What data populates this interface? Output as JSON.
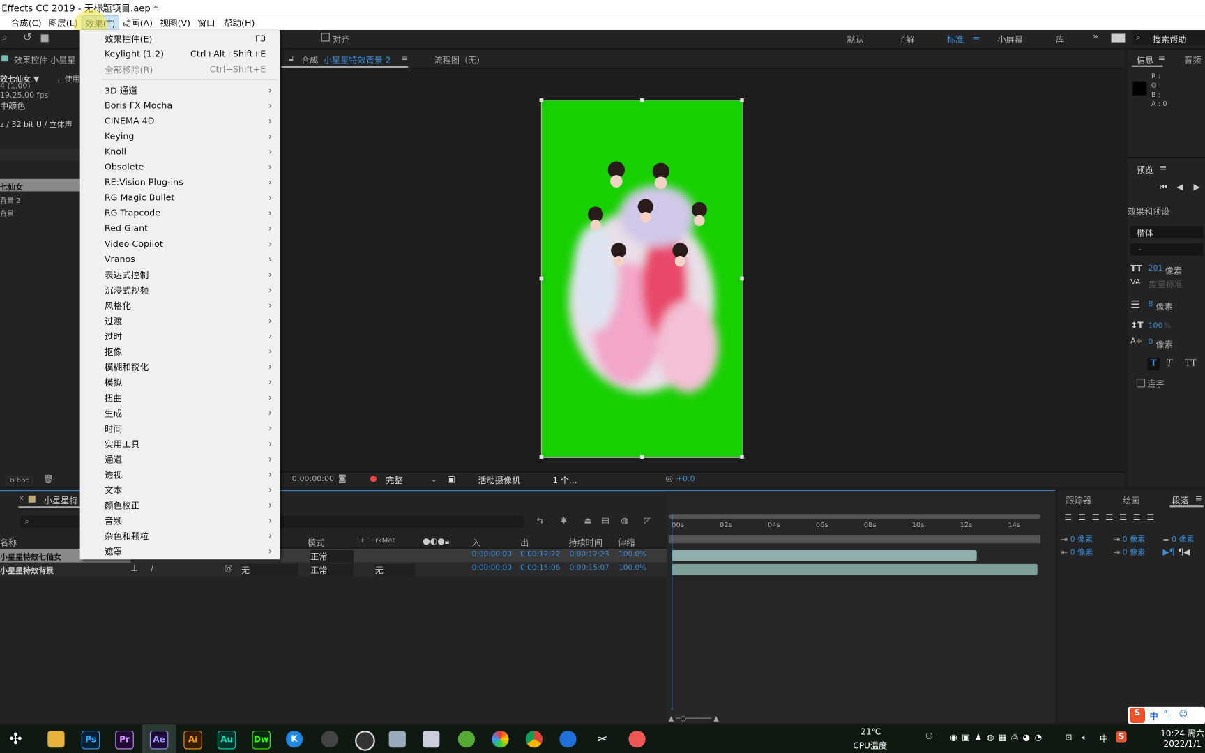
{
  "window": {
    "title": "Effects CC 2019 - 无标题项目.aep *"
  },
  "menubar": {
    "items": [
      "合成(C)",
      "图层(L)",
      "效果(T)",
      "动画(A)",
      "视图(V)",
      "窗口",
      "帮助(H)"
    ],
    "active": "效果(T)"
  },
  "toolbar": {
    "snap_label": "对齐",
    "workspaces": [
      "默认",
      "了解",
      "标准",
      "小屏幕",
      "库"
    ],
    "active_workspace": "标准",
    "more": "»",
    "search_placeholder": "搜索帮助"
  },
  "effects_menu": {
    "top": [
      {
        "label": "效果控件(E)",
        "shortcut": "F3",
        "enabled": true
      },
      {
        "label": "Keylight (1.2)",
        "shortcut": "Ctrl+Alt+Shift+E",
        "enabled": true
      },
      {
        "label": "全部移除(R)",
        "shortcut": "Ctrl+Shift+E",
        "enabled": false
      }
    ],
    "categories": [
      "3D 通道",
      "Boris FX Mocha",
      "CINEMA 4D",
      "Keying",
      "Knoll",
      "Obsolete",
      "RE:Vision Plug-ins",
      "RG Magic Bullet",
      "RG Trapcode",
      "Red Giant",
      "Video Copilot",
      "Vranos",
      "表达式控制",
      "沉浸式视频",
      "风格化",
      "过渡",
      "过时",
      "抠像",
      "模糊和锐化",
      "模拟",
      "扭曲",
      "生成",
      "时间",
      "实用工具",
      "通道",
      "透视",
      "文本",
      "颜色校正",
      "音频",
      "杂色和颗粒",
      "遮罩"
    ]
  },
  "project_panel": {
    "tab": "效果控件 小星星",
    "name": "效七仙女 ▼",
    "used": "，使用了",
    "line1": "4 (1.00)",
    "line2": "19,25.00 fps",
    "line3": "中颜色",
    "line4": "z / 32 bit U / 立体声",
    "items": [
      "七仙女",
      "背景 2",
      "背景"
    ],
    "bpc": "8 bpc"
  },
  "viewer": {
    "tab_prefix": "合成",
    "comp_name": "小星星特效背景 2",
    "flowchart": "流程图（无）",
    "timecode": "0:00:00:00",
    "resolution": "完整",
    "camera": "活动摄像机",
    "views": "1 个...",
    "exposure": "+0.0",
    "bg_color": "#16d000"
  },
  "info_panel": {
    "tab": "信息",
    "tab2": "音频",
    "r": "R :",
    "g": "G :",
    "b": "B :",
    "a": "A : 0"
  },
  "preview_panel": {
    "tab": "预览"
  },
  "effects_presets": {
    "tab": "效果和预设"
  },
  "character": {
    "font": "楷体",
    "style": "-",
    "size_val": "201",
    "size_unit": "像素",
    "kerning": "度量标准",
    "leading_val": "8",
    "leading_unit": "像素",
    "scale_val": "100",
    "scale_unit": "%",
    "baseline_val": "0",
    "baseline_unit": "像素",
    "ligature": "连字"
  },
  "timeline": {
    "tab": "小星星特",
    "columns": {
      "name": "名称",
      "mode": "模式",
      "t": "T",
      "trkmat": "TrkMat",
      "in": "入",
      "out": "出",
      "duration": "持续时间",
      "stretch": "伸缩"
    },
    "layers": [
      {
        "name": "小星星特效七仙女",
        "parent": "",
        "mode": "正常",
        "trkmat": "",
        "in": "0:00:00:00",
        "out": "0:00:12:22",
        "duration": "0:00:12:23",
        "stretch": "100.0%",
        "selected": true,
        "bar_end": 0.835
      },
      {
        "name": "小星星特效背景",
        "parent": "无",
        "mode": "正常",
        "trkmat": "无",
        "in": "0:00:00:00",
        "out": "0:00:15:06",
        "duration": "0:00:15:07",
        "stretch": "100.0%",
        "selected": false,
        "bar_end": 1.0
      }
    ],
    "ruler": [
      "00s",
      "02s",
      "04s",
      "06s",
      "08s",
      "10s",
      "12s",
      "14s"
    ]
  },
  "paragraph_panel": {
    "tabs": [
      "跟踪器",
      "绘画",
      "段落"
    ],
    "active": "段落",
    "indent_left": "0 像素",
    "indent_right": "0 像素",
    "space_before": "0 像素",
    "space_after": "0 像素",
    "first_line": "0 像素"
  },
  "taskbar": {
    "apps": [
      "Ps",
      "Pr",
      "Ae",
      "Ai",
      "Au",
      "Dw",
      "K"
    ],
    "active": "Ae",
    "temp": "21℃",
    "temp_label": "CPU温度",
    "ime": "中",
    "time": "10:24 周六",
    "date": "2022/1/1"
  }
}
